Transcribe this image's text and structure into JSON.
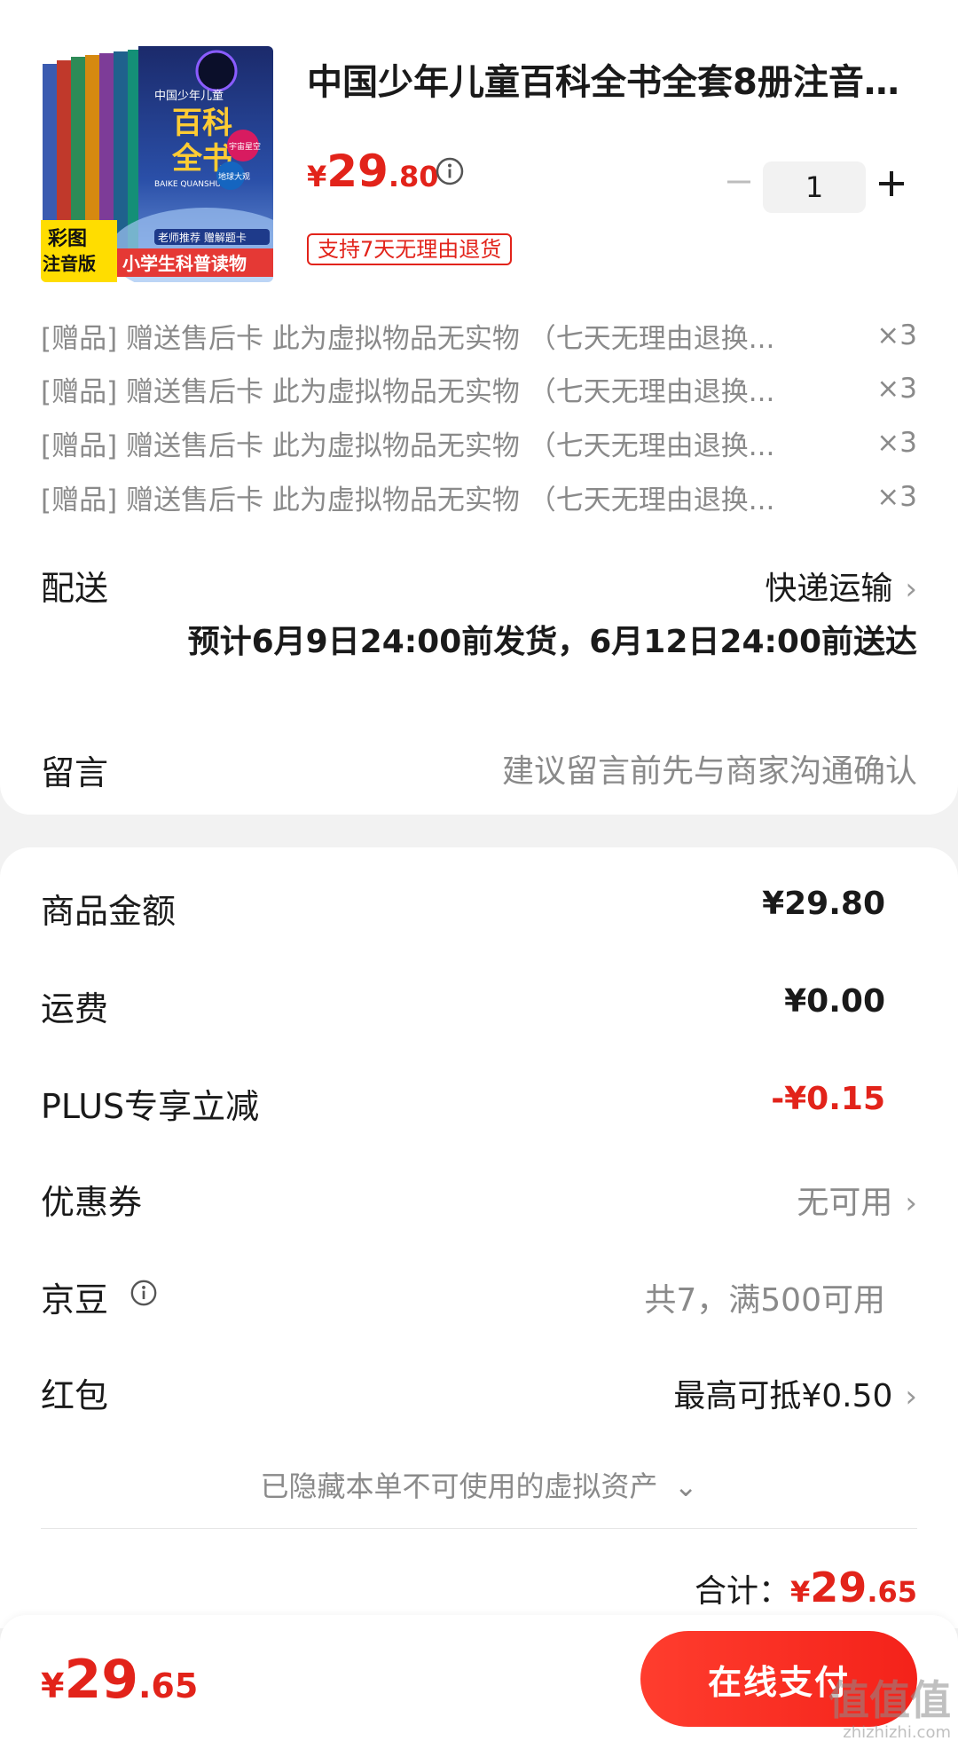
{
  "product": {
    "title": "中国少年儿童百科全书全套8册注音...",
    "price_currency": "¥",
    "price_int": "29",
    "price_dec": ".80",
    "quantity": "1",
    "return_policy": "支持7天无理由退货",
    "image_texts": {
      "title_top": "中国少年儿童",
      "title_main1": "百科",
      "title_main2": "全书",
      "pinyin": "BAIKE QUANSHU",
      "badge1": "宇宙星空",
      "badge2": "地球大观",
      "corner_label1": "彩图",
      "corner_label2": "注音版",
      "promo": "老师推荐 赠解题卡",
      "banner": "小学生科普读物"
    }
  },
  "gifts": [
    {
      "text": "[赠品] 赠送售后卡 此为虚拟物品无实物 （七天无理由退换...",
      "count": "×3"
    },
    {
      "text": "[赠品] 赠送售后卡 此为虚拟物品无实物 （七天无理由退换...",
      "count": "×3"
    },
    {
      "text": "[赠品] 赠送售后卡 此为虚拟物品无实物 （七天无理由退换...",
      "count": "×3"
    },
    {
      "text": "[赠品] 赠送售后卡 此为虚拟物品无实物 （七天无理由退换...",
      "count": "×3"
    }
  ],
  "delivery": {
    "label": "配送",
    "method": "快递运输",
    "estimate": "预计6月9日24:00前发货，6月12日24:00前送达"
  },
  "message": {
    "label": "留言",
    "placeholder": "建议留言前先与商家沟通确认"
  },
  "fees": {
    "goods_amount": {
      "label": "商品金额",
      "value": "¥29.80"
    },
    "shipping": {
      "label": "运费",
      "value": "¥0.00"
    },
    "plus_discount": {
      "label": "PLUS专享立减",
      "value": "-¥0.15"
    },
    "coupon": {
      "label": "优惠券",
      "value": "无可用"
    },
    "jingdou": {
      "label": "京豆",
      "value": "共7，满500可用"
    },
    "red_packet": {
      "label": "红包",
      "value": "最高可抵¥0.50"
    }
  },
  "hidden_assets": "已隐藏本单不可使用的虚拟资产",
  "subtotal": {
    "label": "合计：",
    "currency": "¥",
    "int": "29",
    "dec": ".65"
  },
  "bottom": {
    "currency": "¥",
    "total_int": "29",
    "total_dec": ".65",
    "pay_label": "在线支付"
  },
  "watermark": {
    "main": "值值值",
    "sub": "zhizhizhi.com"
  },
  "colors": {
    "accent": "#e2231a",
    "muted": "#8a8a8a",
    "background": "#f2f2f2"
  }
}
